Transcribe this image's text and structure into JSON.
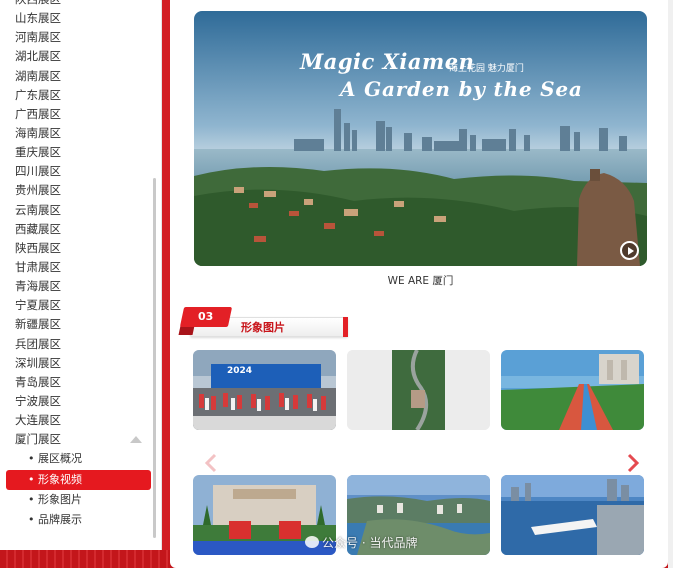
{
  "sidebar": {
    "items": [
      {
        "label": "陕西展区"
      },
      {
        "label": "山东展区"
      },
      {
        "label": "河南展区"
      },
      {
        "label": "湖北展区"
      },
      {
        "label": "湖南展区"
      },
      {
        "label": "广东展区"
      },
      {
        "label": "广西展区"
      },
      {
        "label": "海南展区"
      },
      {
        "label": "重庆展区"
      },
      {
        "label": "四川展区"
      },
      {
        "label": "贵州展区"
      },
      {
        "label": "云南展区"
      },
      {
        "label": "西藏展区"
      },
      {
        "label": "陕西展区"
      },
      {
        "label": "甘肃展区"
      },
      {
        "label": "青海展区"
      },
      {
        "label": "宁夏展区"
      },
      {
        "label": "新疆展区"
      },
      {
        "label": "兵团展区"
      },
      {
        "label": "深圳展区"
      },
      {
        "label": "青岛展区"
      },
      {
        "label": "宁波展区"
      },
      {
        "label": "大连展区"
      }
    ],
    "expanded": {
      "label": "厦门展区",
      "icon": "caret-up-icon"
    },
    "sub_items": [
      {
        "label": "• 展区概况",
        "active": false
      },
      {
        "label": "• 形象视频",
        "active": true
      },
      {
        "label": "• 形象图片",
        "active": false
      },
      {
        "label": "• 品牌展示",
        "active": false
      }
    ]
  },
  "video": {
    "title_en_1": "Magic Xiamen",
    "title_cn": "海上花园 魅力厦门",
    "title_en_2": "A Garden by the Sea",
    "caption": "WE ARE 厦门",
    "play_icon": "play-icon"
  },
  "section": {
    "number": "03",
    "title": "形象图片"
  },
  "gallery": {
    "marathon_banner": "2024",
    "prev_icon": "chevron-left-icon",
    "next_icon": "chevron-right-icon"
  },
  "watermark": {
    "text": "公众号 · 当代品牌"
  },
  "colors": {
    "brand_red": "#e32026",
    "active_bg": "#e5191f",
    "page_bg": "#b81414"
  }
}
